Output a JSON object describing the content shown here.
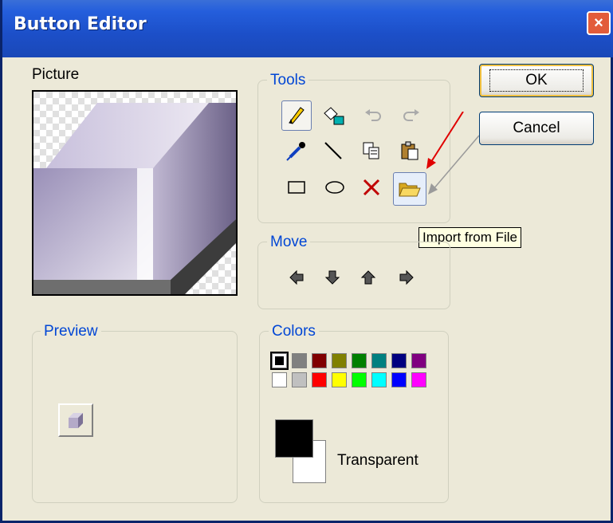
{
  "window": {
    "title": "Button Editor",
    "close_glyph": "×"
  },
  "picture": {
    "label": "Picture"
  },
  "tools": {
    "title": "Tools",
    "items": [
      {
        "name": "pencil-icon",
        "selected": true
      },
      {
        "name": "fill-bucket-icon"
      },
      {
        "name": "undo-icon",
        "disabled": true
      },
      {
        "name": "redo-icon",
        "disabled": true
      },
      {
        "name": "eyedropper-icon"
      },
      {
        "name": "line-icon"
      },
      {
        "name": "copy-icon"
      },
      {
        "name": "paste-icon"
      },
      {
        "name": "rectangle-icon"
      },
      {
        "name": "ellipse-icon"
      },
      {
        "name": "clear-icon"
      },
      {
        "name": "import-folder-icon",
        "hover": true
      }
    ],
    "tooltip": "Import from File"
  },
  "move": {
    "title": "Move",
    "items": [
      "arrow-left-icon",
      "arrow-down-icon",
      "arrow-up-icon",
      "arrow-right-icon"
    ]
  },
  "preview": {
    "title": "Preview"
  },
  "colors": {
    "title": "Colors",
    "palette_row1": [
      "#000000",
      "#808080",
      "#800000",
      "#808000",
      "#008000",
      "#008080",
      "#000080",
      "#800080"
    ],
    "palette_row2": [
      "#ffffff",
      "#c0c0c0",
      "#ff0000",
      "#ffff00",
      "#00ff00",
      "#00ffff",
      "#0000ff",
      "#ff00ff"
    ],
    "foreground": "#000000",
    "background_label": "Transparent"
  },
  "buttons": {
    "ok": "OK",
    "cancel": "Cancel"
  }
}
